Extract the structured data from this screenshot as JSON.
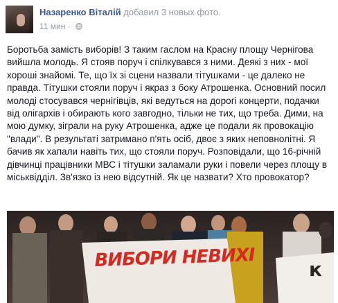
{
  "post": {
    "author": "Назаренко Віталій",
    "action": "добавил 3 новых фото.",
    "time": "11 мин",
    "separator": "·",
    "text": "Боротьба замість виборів! З таким гаслом на Красну площу Чернігова вийшла молодь. Я стояв поруч і спілкувався з ними. Деякі з них - мої хороші знайомі. Те, що їх зі сцени назвали тітушками - це далеко не правда. Тітушки стояли поруч і якраз з боку Атрошенка. Основний посил молоді стосувався чернігівців, які ведуться на дорогі концерти, подачки від олігархів і обирають кого завгодно, тільки не тих, що треба. Дими, на мою думку, зіграли на руку Атрошенка, адже це подали як провокацію \"влади\". В результаті затримано п'ять осіб, двоє з яких неповнолітні. Я бачив як хапали навіть тих, що стояли поруч. Розповідали, що 16-річній дівчинці працівники МВС і тітушки заламали руки і повели через площу в міськвідділ. Зв'язко із нею відсутній. Як це назвати? Хто провокатор?"
  },
  "photo": {
    "banner_left": "ВИБОРИ НЕВИХІ",
    "banner_right": "к"
  },
  "colors": {
    "link": "#3b5998",
    "text": "#141823",
    "meta": "#9197a3",
    "banner_ink": "#d42a22"
  },
  "icons": {
    "privacy": "globe-icon"
  }
}
